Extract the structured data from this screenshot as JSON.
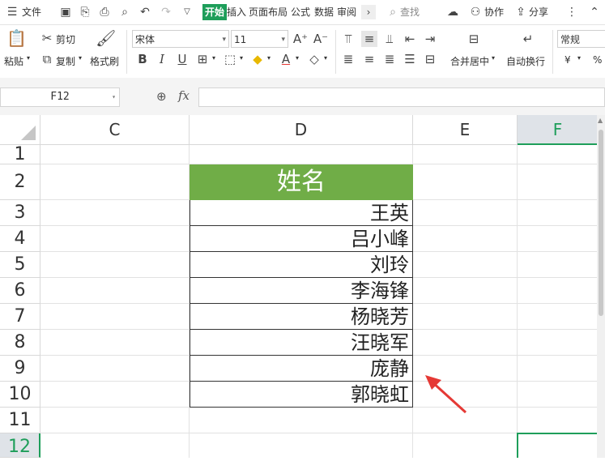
{
  "menubar": {
    "file_label": "文件",
    "tabs": [
      "开始",
      "插入",
      "页面布局",
      "公式",
      "数据",
      "审阅"
    ],
    "search_label": "查找",
    "collab_label": "协作",
    "share_label": "分享"
  },
  "ribbon": {
    "paste_label": "粘贴",
    "cut_label": "剪切",
    "copy_label": "复制",
    "format_painter_label": "格式刷",
    "font_name": "宋体",
    "font_size": "11",
    "merge_label": "合并居中",
    "wrap_label": "自动换行",
    "number_format": "常规",
    "currency_symbol": "¥",
    "percent_symbol": "%"
  },
  "formula": {
    "cell_ref": "F12",
    "fx_label": "fx",
    "value": ""
  },
  "sheet": {
    "columns": [
      "C",
      "D",
      "E",
      "F"
    ],
    "rows": [
      "1",
      "2",
      "3",
      "4",
      "5",
      "6",
      "7",
      "8",
      "9",
      "10",
      "11",
      "12"
    ],
    "header": "姓名",
    "names": [
      "王英",
      "吕小峰",
      "刘玲",
      "李海锋",
      "杨晓芳",
      "汪晓军",
      "庞静",
      "郭晓虹"
    ],
    "selected_cell": "F12"
  },
  "colors": {
    "accent": "#1e9e5a",
    "header_fill": "#70ad47",
    "arrow": "#e53935"
  }
}
